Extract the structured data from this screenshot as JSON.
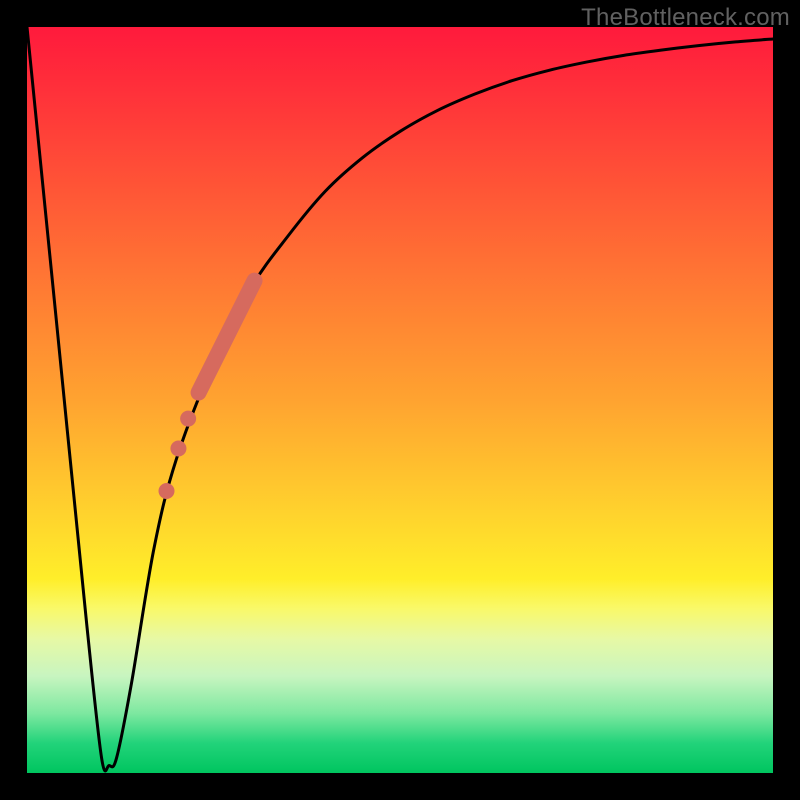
{
  "watermark": {
    "text": "TheBottleneck.com"
  },
  "colors": {
    "curve_stroke": "#000000",
    "marker_fill": "#d66a5e",
    "marker_stroke": "#d66a5e"
  },
  "chart_data": {
    "type": "line",
    "title": "",
    "xlabel": "",
    "ylabel": "",
    "xlim": [
      0,
      100
    ],
    "ylim": [
      0,
      100
    ],
    "grid": false,
    "legend": false,
    "series": [
      {
        "name": "bottleneck-curve",
        "x": [
          0,
          4,
          8,
          10,
          11,
          12,
          14,
          17,
          20,
          25,
          30,
          35,
          40,
          45,
          50,
          55,
          60,
          65,
          70,
          75,
          80,
          85,
          90,
          95,
          100
        ],
        "values": [
          100,
          60,
          20,
          2,
          1,
          2,
          12,
          30,
          42,
          55,
          65,
          72,
          78,
          82.5,
          86,
          88.8,
          91,
          92.8,
          94.2,
          95.3,
          96.2,
          96.9,
          97.5,
          98,
          98.4
        ]
      }
    ],
    "markers": [
      {
        "name": "thick-segment",
        "kind": "segment",
        "x": [
          23,
          30.5
        ],
        "y": [
          51,
          66
        ],
        "width": 16
      },
      {
        "name": "dot-1",
        "kind": "dot",
        "x": 21.6,
        "y": 47.5,
        "r": 8
      },
      {
        "name": "dot-2",
        "kind": "dot",
        "x": 20.3,
        "y": 43.5,
        "r": 8
      },
      {
        "name": "dot-3",
        "kind": "dot",
        "x": 18.7,
        "y": 37.8,
        "r": 8
      }
    ]
  }
}
